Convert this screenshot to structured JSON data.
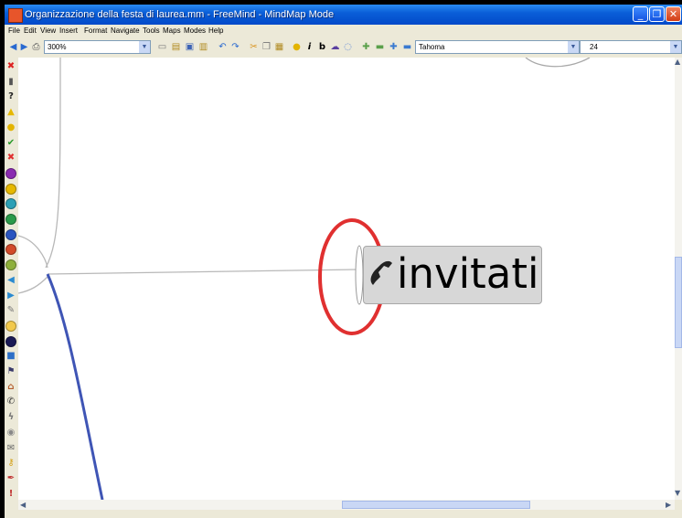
{
  "window": {
    "title": "Organizzazione della festa di laurea.mm - FreeMind - MindMap Mode",
    "controls": [
      "minimize",
      "maximize",
      "close"
    ]
  },
  "menu": [
    "File",
    "Edit",
    "View",
    "Insert",
    "Format",
    "Navigate",
    "Tools",
    "Maps",
    "Modes",
    "Help"
  ],
  "toolbar": {
    "zoom": "300%",
    "font_family": "Tahoma",
    "font_size": "24"
  },
  "icons_sidebar": [
    "remove-icon",
    "trash-icon",
    "question-icon",
    "warning-icon",
    "idea-icon",
    "ok-icon",
    "cancel-icon",
    "priority-1-icon",
    "priority-2-icon",
    "priority-3-icon",
    "priority-4-icon",
    "priority-5-icon",
    "priority-6-icon",
    "priority-7-icon",
    "back-icon",
    "forward-icon",
    "pencil-icon",
    "smiley-icon",
    "bomb-icon",
    "folder-icon",
    "flag-icon",
    "home-icon",
    "phone-icon",
    "lightning-icon",
    "eye-icon",
    "mail-icon",
    "key-icon",
    "pen-icon",
    "exclamation-icon"
  ],
  "node": {
    "text": "invitati",
    "icon": "phone-icon"
  },
  "colors": {
    "titlebar": "#0a5fd8",
    "node_bg": "#d7d7d7",
    "edge_blue": "#3f55b5",
    "annotation_red": "#e03030"
  }
}
